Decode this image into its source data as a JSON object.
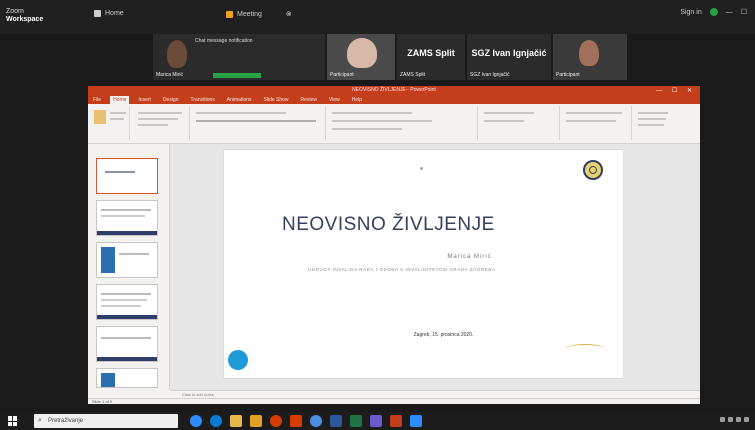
{
  "zoom": {
    "app_name_line1": "Zoom",
    "app_name_line2": "Workspace",
    "tab_home": "Home",
    "tab_meeting": "Meeting",
    "right_label": "Sign in"
  },
  "participants": {
    "p1_label": "Marica Mirić",
    "chat_text": "Chat message notification",
    "p2_label": "Participant",
    "p3_big": "ZAMS Split",
    "p3_label": "ZAMS Split",
    "p4_big": "SGZ Ivan Ignjačić",
    "p4_label": "SGZ Ivan Ignjačić",
    "p5_label": "Participant"
  },
  "ppt": {
    "window_title": "NEOVISNO ŽIVLJENJE - PowerPoint",
    "window_controls": "— ☐ ✕",
    "tabs": [
      "File",
      "Home",
      "Insert",
      "Design",
      "Transitions",
      "Animations",
      "Slide Show",
      "Review",
      "View",
      "Help"
    ],
    "active_tab": "Home",
    "notes_placeholder": "Click to add notes",
    "status_left": "Slide 1 of 5"
  },
  "slide": {
    "title": "NEOVISNO ŽIVLJENJE",
    "author": "Marica Mirić",
    "org": "UDRUGA INVALIDA RADA I OSOBA S INVALIDITETOM GRADA ZAGREBA",
    "date": "Zagreb, 15. prosinca 2020."
  },
  "taskbar": {
    "search_placeholder": "Pretraživanje"
  },
  "colors": {
    "ppt_accent": "#c43e1c",
    "zoom_active_speaker": "#25a244",
    "slide_title": "#33415c"
  }
}
